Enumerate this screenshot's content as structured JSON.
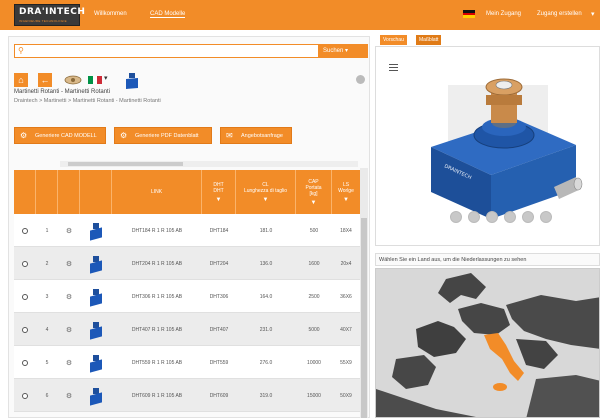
{
  "header": {
    "logo_main": "DRA'INTECH",
    "logo_sub": "INGENIEURE TECHNOLOGIE",
    "nav": [
      "Willkommen",
      "CAD Modelle"
    ],
    "login": "Mein Zugang",
    "register": "Zugang erstellen"
  },
  "search": {
    "placeholder": "",
    "button": "Suchen"
  },
  "breadcrumb": {
    "title": "Martinetti Rotanti - Martinetti Rotanti",
    "path": "Draintech  >  Martinetti  >  Martinetti Rotanti - Martinetti Rotanti"
  },
  "actions": [
    "Generiere CAD MODELL",
    "Generiere PDF Datenblatt",
    "Angebotsanfrage"
  ],
  "table": {
    "columns": [
      {
        "label": "",
        "filter": false
      },
      {
        "label": "",
        "filter": false
      },
      {
        "label": "",
        "filter": false
      },
      {
        "label": "",
        "filter": false
      },
      {
        "label": "LINK",
        "filter": false
      },
      {
        "label": "DHT\nDHT",
        "filter": true
      },
      {
        "label": "CL\nLunghezza di taglio",
        "filter": true
      },
      {
        "label": "CAP\nPortata\n[kg]",
        "filter": true
      },
      {
        "label": "LS\nWorlge",
        "filter": true
      }
    ],
    "rows": [
      {
        "num": "1",
        "link": "DHT184 R 1 R 105 AB",
        "dht": "DHT184",
        "cl": "181.0",
        "cap": "500",
        "ls": "18X4"
      },
      {
        "num": "2",
        "link": "DHT204 R 1 R 105 AB",
        "dht": "DHT204",
        "cl": "136.0",
        "cap": "1600",
        "ls": "20x4"
      },
      {
        "num": "3",
        "link": "DHT306 R 1 R 105 AB",
        "dht": "DHT306",
        "cl": "164.0",
        "cap": "2500",
        "ls": "36X6"
      },
      {
        "num": "4",
        "link": "DHT407 R 1 R 105 AB",
        "dht": "DHT407",
        "cl": "231.0",
        "cap": "5000",
        "ls": "40X7"
      },
      {
        "num": "5",
        "link": "DHT559 R 1 R 105 AB",
        "dht": "DHT559",
        "cl": "276.0",
        "cap": "10000",
        "ls": "55X9"
      },
      {
        "num": "6",
        "link": "DHT609 R 1 R 105 AB",
        "dht": "DHT609",
        "cl": "319.0",
        "cap": "15000",
        "ls": "50X9"
      }
    ]
  },
  "viewer_tabs": [
    "Vorschau",
    "Maßblatt"
  ],
  "map": {
    "title": "Wählen Sie ein Land aus, um die Niederlassungen zu sehen"
  },
  "colors": {
    "accent": "#f28c28",
    "model_blue": "#1c58b8",
    "model_bronze": "#c98a4a"
  },
  "icons": [
    "search-icon",
    "home-icon",
    "back-arrow-icon",
    "gear-icon",
    "hamburger-icon",
    "filter-icon"
  ]
}
